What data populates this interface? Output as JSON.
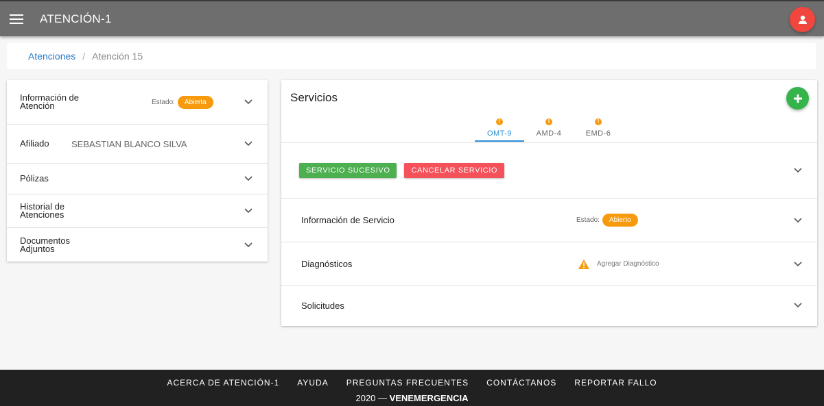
{
  "header": {
    "title": "ATENCIÓN-1",
    "menu_icon": "menu-icon",
    "avatar_icon": "user-icon",
    "avatar_color": "#f0463e"
  },
  "breadcrumb": {
    "parent": "Atenciones",
    "separator": "/",
    "current": "Atención 15"
  },
  "left_panel": {
    "info": {
      "title_line1": "Información de",
      "title_line2": "Atención",
      "estado_label": "Estado:",
      "estado_value": "Abierta"
    },
    "afiliado": {
      "title": "Afiliado",
      "value": "SEBASTIAN BLANCO SILVA"
    },
    "polizas": {
      "title": "Pólizas"
    },
    "historial": {
      "title_line1": "Historial de",
      "title_line2": "Atenciones"
    },
    "documentos": {
      "title_line1": "Documentos",
      "title_line2": "Adjuntos"
    }
  },
  "services": {
    "title": "Servicios",
    "add_icon": "plus-icon",
    "tabs": [
      {
        "label": "OMT-9",
        "active": true,
        "alert": "!"
      },
      {
        "label": "AMD-4",
        "active": false,
        "alert": "!"
      },
      {
        "label": "EMD-6",
        "active": false,
        "alert": "!"
      }
    ],
    "actions": {
      "sucesivo": "SERVICIO SUCESIVO",
      "cancelar": "CANCELAR SERVICIO"
    },
    "info_servicio": {
      "title": "Información de Servicio",
      "estado_label": "Estado:",
      "estado_value": "Abierto"
    },
    "diagnosticos": {
      "title": "Diagnósticos",
      "warning": "Agregar Diagnóstico"
    },
    "solicitudes": {
      "title": "Solicitudes"
    }
  },
  "footer": {
    "links": [
      "ACERCA DE ATENCIÓN-1",
      "AYUDA",
      "PREGUNTAS FRECUENTES",
      "CONTÁCTANOS",
      "REPORTAR FALLO"
    ],
    "year": "2020 —",
    "brand": "VENEMERGENCIA"
  },
  "colors": {
    "accent": "#2a8fd4",
    "badge": "#f89a0e",
    "success": "#4caf50",
    "danger": "#f4515a"
  }
}
